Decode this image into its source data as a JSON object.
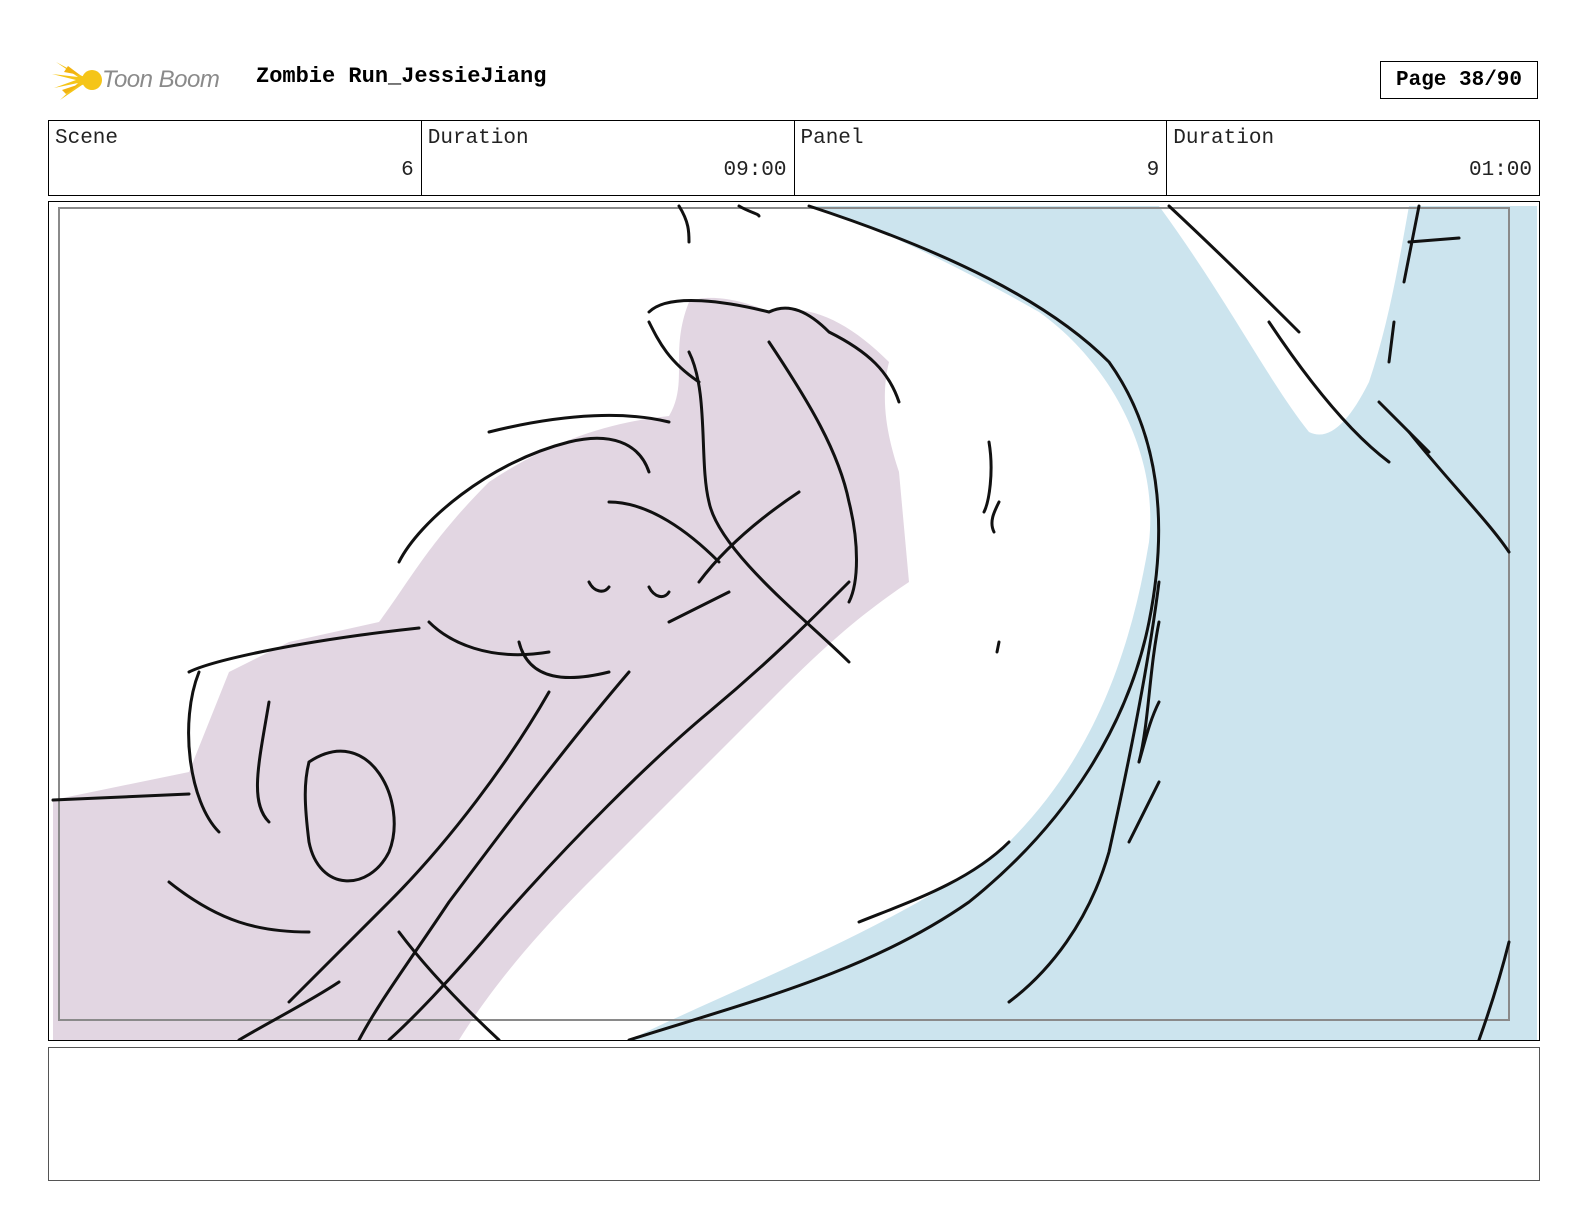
{
  "header": {
    "logo_text": "Toon Boom",
    "project_title": "Zombie Run_JessieJiang",
    "page_label": "Page 38/90"
  },
  "info": {
    "scene_label": "Scene",
    "scene_value": "6",
    "scene_duration_label": "Duration",
    "scene_duration_value": "09:00",
    "panel_label": "Panel",
    "panel_value": "9",
    "panel_duration_label": "Duration",
    "panel_duration_value": "01:00"
  },
  "colors": {
    "character_fill": "#e2d6e2",
    "sky_fill": "#cce4ee",
    "ink": "#111111",
    "logo_yellow": "#f5c518",
    "logo_grey": "#8a8a8a"
  },
  "notes": {
    "text": ""
  }
}
